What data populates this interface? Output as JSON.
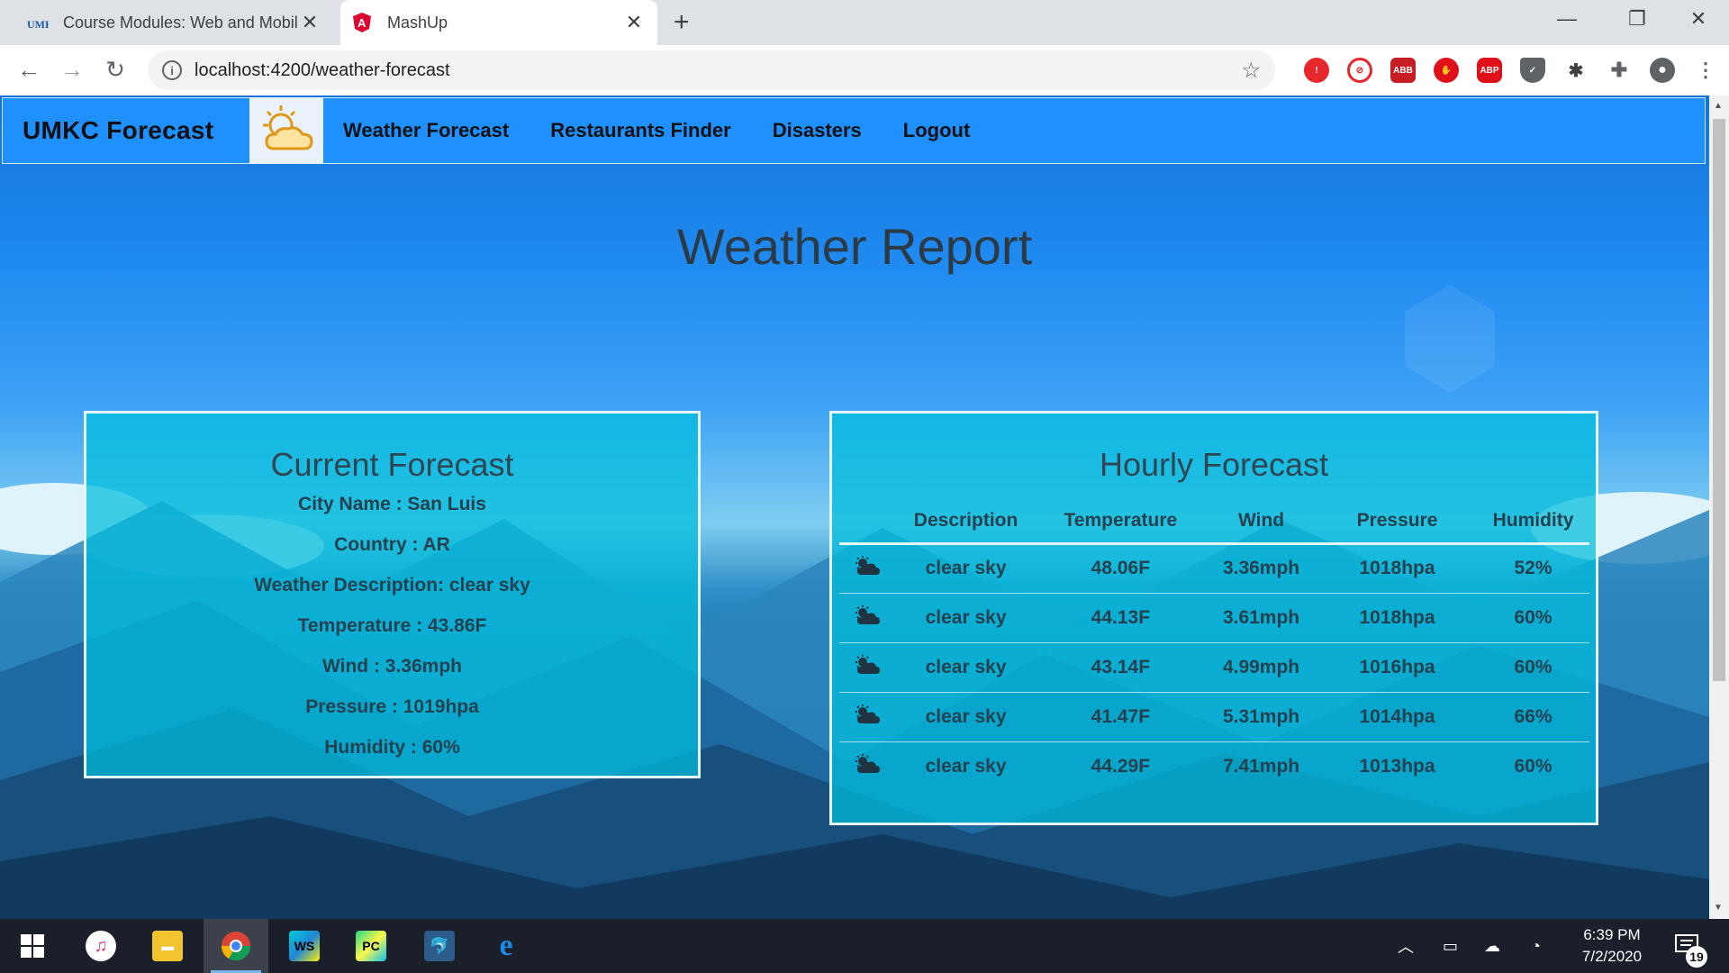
{
  "browser": {
    "tabs": [
      {
        "title": "Course Modules: Web and Mobil",
        "favicon": "umkc-favicon",
        "active": false
      },
      {
        "title": "MashUp",
        "favicon": "angular-favicon",
        "active": true
      }
    ],
    "url": "localhost:4200/weather-forecast",
    "extensions": [
      "ext-red-alert-icon",
      "ext-red-circle-icon",
      "ext-abp-shield-icon",
      "ext-red-hand-icon",
      "ext-abp-icon",
      "ext-shield-icon",
      "ext-bug-icon",
      "extensions-puzzle-icon",
      "profile-icon"
    ]
  },
  "navbar": {
    "brand": "UMKC Forecast",
    "links": [
      "Weather Forecast",
      "Restaurants Finder",
      "Disasters",
      "Logout"
    ]
  },
  "page": {
    "title": "Weather Report"
  },
  "current": {
    "title": "Current Forecast",
    "lines": [
      "City Name : San Luis",
      "Country : AR",
      "Weather Description: clear sky",
      "Temperature : 43.86F",
      "Wind : 3.36mph",
      "Pressure : 1019hpa",
      "Humidity : 60%"
    ]
  },
  "hourly": {
    "title": "Hourly Forecast",
    "columns": [
      "",
      "Description",
      "Temperature",
      "Wind",
      "Pressure",
      "Humidity"
    ],
    "rows": [
      {
        "icon": "cloud-sun-icon",
        "description": "clear sky",
        "temperature": "48.06F",
        "wind": "3.36mph",
        "pressure": "1018hpa",
        "humidity": "52%"
      },
      {
        "icon": "cloud-sun-icon",
        "description": "clear sky",
        "temperature": "44.13F",
        "wind": "3.61mph",
        "pressure": "1018hpa",
        "humidity": "60%"
      },
      {
        "icon": "cloud-sun-icon",
        "description": "clear sky",
        "temperature": "43.14F",
        "wind": "4.99mph",
        "pressure": "1016hpa",
        "humidity": "60%"
      },
      {
        "icon": "cloud-sun-icon",
        "description": "clear sky",
        "temperature": "41.47F",
        "wind": "5.31mph",
        "pressure": "1014hpa",
        "humidity": "66%"
      },
      {
        "icon": "cloud-sun-icon",
        "description": "clear sky",
        "temperature": "44.29F",
        "wind": "7.41mph",
        "pressure": "1013hpa",
        "humidity": "60%"
      }
    ]
  },
  "taskbar": {
    "apps": [
      "itunes-icon",
      "file-explorer-icon",
      "chrome-icon",
      "webstorm-icon",
      "pycharm-icon",
      "mysql-workbench-icon",
      "edge-icon"
    ],
    "active_app": "chrome-icon",
    "time": "6:39 PM",
    "date": "7/2/2020",
    "notification_count": "19"
  },
  "colors": {
    "navbar": "#1e90ff",
    "panel": "#00bedc",
    "panel_border": "#e6f7fb",
    "text_dark": "#23414f"
  }
}
